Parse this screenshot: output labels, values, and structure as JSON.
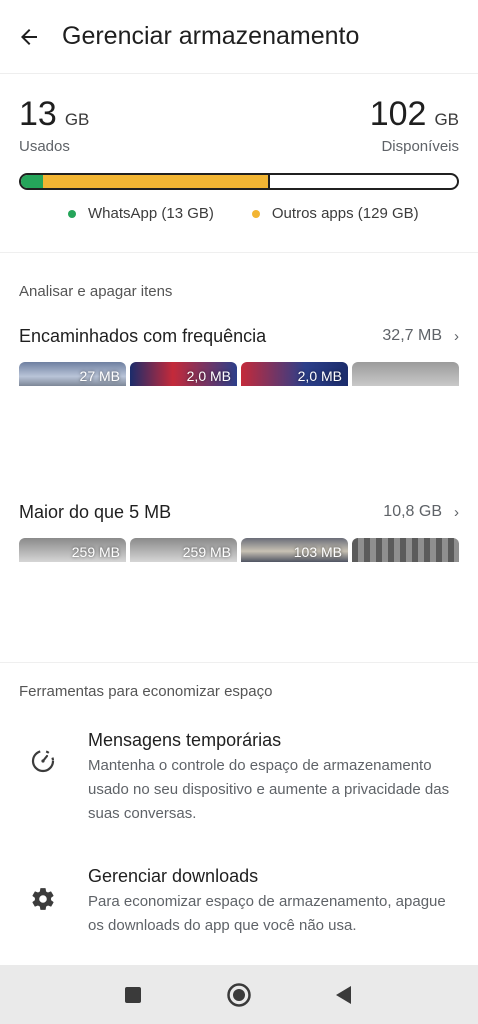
{
  "header": {
    "title": "Gerenciar armazenamento"
  },
  "usage": {
    "used_value": "13",
    "used_unit": "GB",
    "used_label": "Usados",
    "available_value": "102",
    "available_unit": "GB",
    "available_label": "Disponíveis",
    "whatsapp_fraction": 0.05,
    "others_fraction": 0.57
  },
  "legend": {
    "whatsapp": "WhatsApp (13 GB)",
    "others": "Outros apps (129 GB)",
    "whatsapp_color": "#25a55a",
    "others_color": "#f2b533"
  },
  "analyze": {
    "section_title": "Analisar e apagar itens",
    "forwarded": {
      "title": "Encaminhados com frequência",
      "size": "32,7 MB",
      "thumbs": [
        "27 MB",
        "2,0 MB",
        "2,0 MB",
        ""
      ]
    },
    "large": {
      "title": "Maior do que 5 MB",
      "size": "10,8 GB",
      "thumbs": [
        "259 MB",
        "259 MB",
        "103 MB",
        ""
      ]
    }
  },
  "tools": {
    "section_title": "Ferramentas para economizar espaço",
    "temporary": {
      "title": "Mensagens temporárias",
      "description": "Mantenha o controle do espaço de armazenamento usado no seu dispositivo e aumente a privacidade das suas conversas.",
      "icon": "timer-icon"
    },
    "downloads": {
      "title": "Gerenciar downloads",
      "description": "Para economizar espaço de armazenamento, apague os downloads do app que você não usa.",
      "icon": "gear-icon"
    }
  },
  "navbar": {
    "recents_icon": "square-icon",
    "home_icon": "circle-icon",
    "back_icon": "triangle-back-icon"
  }
}
